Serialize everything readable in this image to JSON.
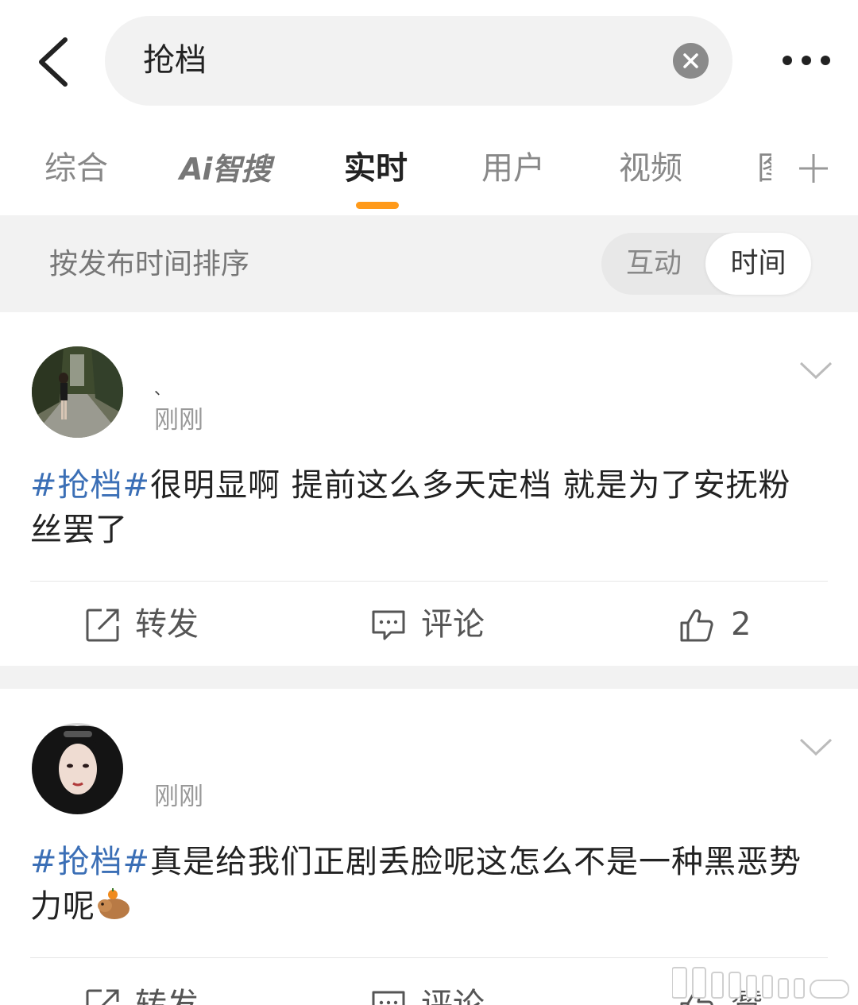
{
  "search": {
    "query": "抢档"
  },
  "tabs": [
    {
      "label": "综合"
    },
    {
      "label": "Ai智搜"
    },
    {
      "label": "实时"
    },
    {
      "label": "用户"
    },
    {
      "label": "视频"
    },
    {
      "label": "图"
    }
  ],
  "sortbar": {
    "label": "按发布时间排序",
    "options": [
      "互动",
      "时间"
    ],
    "selected": "时间"
  },
  "posts": [
    {
      "username": "、",
      "time": "刚刚",
      "hashtag": "#抢档#",
      "text": "很明显啊 提前这么多天定档 就是为了安抚粉丝罢了",
      "repost_label": "转发",
      "comment_label": "评论",
      "like_count": "2"
    },
    {
      "username": "",
      "time": "刚刚",
      "hashtag": "#抢档#",
      "text": "真是给我们正剧丢脸呢这怎么不是一种黑恶势力呢",
      "repost_label": "转发",
      "comment_label": "评论",
      "like_count": "赞"
    }
  ],
  "colors": {
    "accent": "#ff9a1a",
    "hashtag": "#3b6fb6",
    "background_gray": "#f2f2f2"
  }
}
